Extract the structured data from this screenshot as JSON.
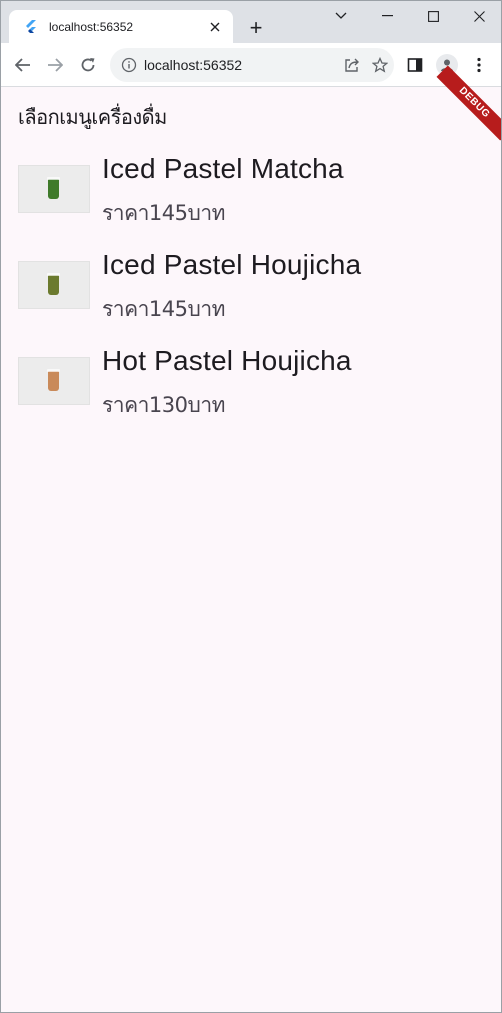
{
  "browser": {
    "tab_title": "localhost:56352",
    "url": "localhost:56352",
    "new_tab_label": "+"
  },
  "page": {
    "title": "เลือกเมนูเครื่องดื่ม",
    "debug_banner": "DEBUG"
  },
  "menu": {
    "items": [
      {
        "name": "Iced Pastel Matcha",
        "price": "ราคา145บาท",
        "cup_color": "#3f7a2a"
      },
      {
        "name": "Iced Pastel Houjicha",
        "price": "ราคา145บาท",
        "cup_color": "#6b7a2e"
      },
      {
        "name": "Hot Pastel Houjicha",
        "price": "ราคา130บาท",
        "cup_color": "#c98a5a"
      }
    ]
  },
  "colors": {
    "page_bg": "#fdf7fb",
    "debug_ribbon": "#b71c1c",
    "flutter_blue": "#42a5f5"
  }
}
